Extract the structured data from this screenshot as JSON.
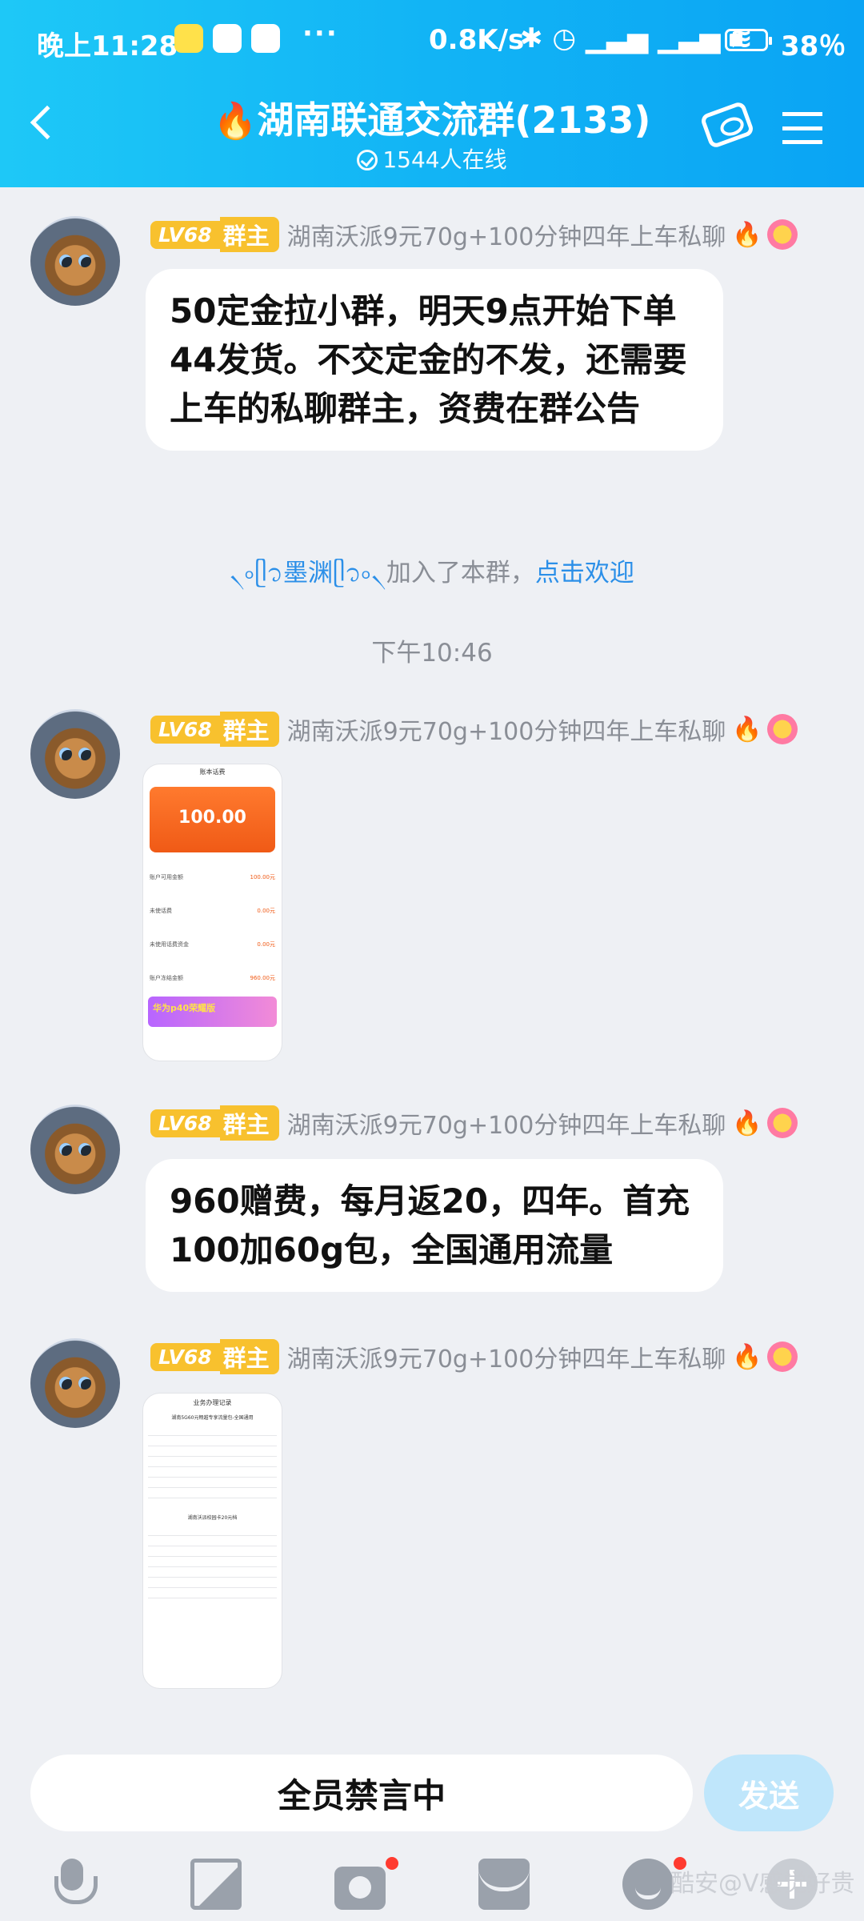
{
  "status_bar": {
    "time": "晚上11:28",
    "dots": "···",
    "speed": "0.8K/s",
    "icons": "✱ ◷ ▁▃▅ ▁▃▅ ≋",
    "battery_percent": 38,
    "battery_label": "38％"
  },
  "header": {
    "title": "湖南联通交流群(2133)",
    "fire_emoji": "🔥",
    "online": "1544人在线"
  },
  "messages": [
    {
      "type": "text",
      "level": "LV68",
      "role": "群主",
      "nickname": "湖南沃派9元70g+100分钟四年上车私聊",
      "text": "50定金拉小群，明天9点开始下单44发货。不交定金的不发，还需要上车的私聊群主，资费在群公告"
    },
    {
      "type": "system",
      "name": "৲৹ᥫ᭡墨渊ᥫ᭡৹৲",
      "text": "加入了本群，",
      "link": "点击欢迎"
    },
    {
      "type": "timestamp",
      "text": "下午10:46"
    },
    {
      "type": "image",
      "level": "LV68",
      "role": "群主",
      "nickname": "湖南沃派9元70g+100分钟四年上车私聊",
      "image": {
        "header": "账本话费",
        "amount": "100.00",
        "rows": [
          {
            "label": "账户可用金额",
            "value": "100.00元"
          },
          {
            "label": "未使话费",
            "value": "0.00元"
          },
          {
            "label": "未使用话费资金",
            "value": "0.00元"
          },
          {
            "label": "账户冻结金额",
            "value": "960.00元"
          }
        ],
        "promo": "华为p40荣耀版"
      }
    },
    {
      "type": "text",
      "level": "LV68",
      "role": "群主",
      "nickname": "湖南沃派9元70g+100分钟四年上车私聊",
      "text": "960赠费，每月返20，四年。首充100加60g包，全国通用流量"
    },
    {
      "type": "image",
      "level": "LV68",
      "role": "群主",
      "nickname": "湖南沃派9元70g+100分钟四年上车私聊",
      "image": {
        "header": "业务办理记录",
        "section1": "湖南5G60元畅越专享流量包-全国通用",
        "section2": "湖南沃派校园卡20元档"
      }
    }
  ],
  "input": {
    "text": "全员禁言中",
    "send_label": "发送"
  },
  "toolbar": {
    "items": [
      "mic-icon",
      "image-icon",
      "camera-icon",
      "red-packet-icon",
      "emoji-icon",
      "plus-icon"
    ]
  },
  "watermark": "酷安@V感觉好贵",
  "colors": {
    "header_start": "#1ec8f7",
    "header_end": "#0aa4f4",
    "badge": "#f8c12e",
    "link": "#2b8fe8",
    "send": "#bfe6fb"
  }
}
